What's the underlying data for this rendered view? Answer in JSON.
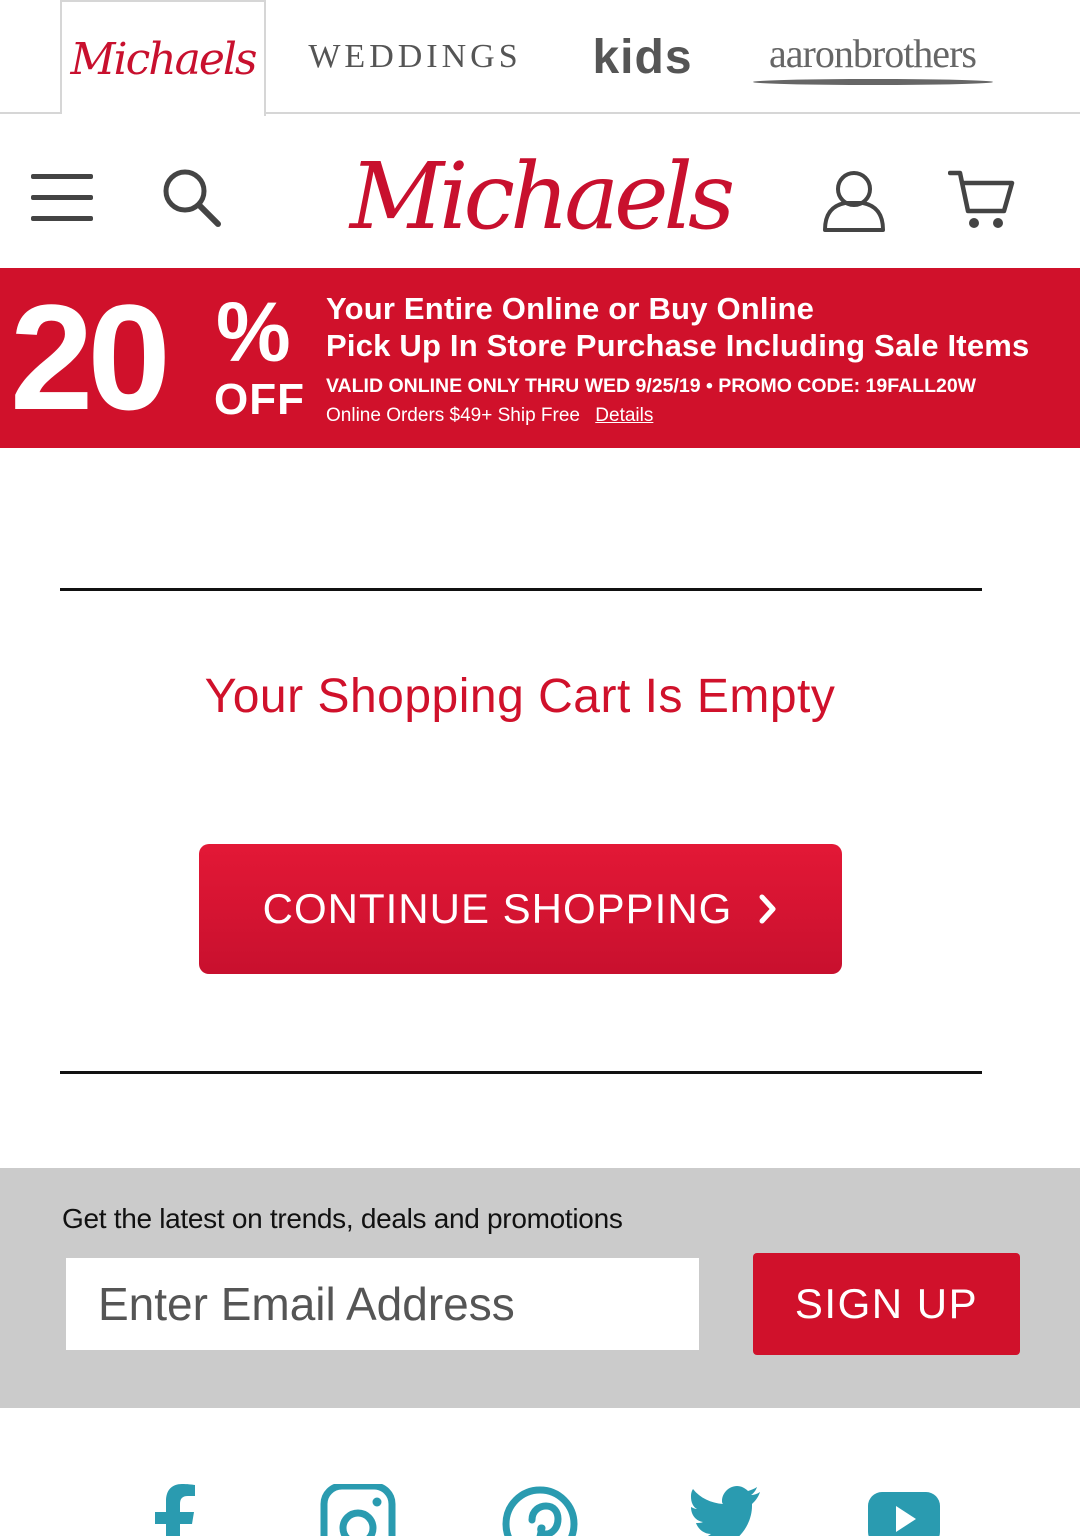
{
  "brand_tabs": {
    "michaels": "Michaels",
    "weddings": "WEDDINGS",
    "kids": "kids",
    "aaron_brothers": "aaronbrothers"
  },
  "header": {
    "logo": "Michaels",
    "icons": [
      "hamburger-menu-icon",
      "search-icon",
      "account-icon",
      "cart-icon"
    ]
  },
  "promo": {
    "percent": "20",
    "percent_sign": "%",
    "off": "OFF",
    "headline_1": "Your Entire Online or Buy Online",
    "headline_2": "Pick Up In Store Purchase Including Sale Items",
    "valid": "VALID ONLINE ONLY THRU WED 9/25/19 • PROMO CODE: 19FALL20W",
    "shipping": "Online Orders $49+ Ship Free",
    "details_link": "Details"
  },
  "cart": {
    "empty_message": "Your Shopping Cart Is Empty",
    "continue_label": "CONTINUE SHOPPING"
  },
  "newsletter": {
    "blurb": "Get the latest on trends, deals and promotions",
    "email_placeholder": "Enter Email Address",
    "email_value": "",
    "signup_label": "SIGN UP"
  },
  "social": {
    "icons": [
      "facebook-icon",
      "instagram-icon",
      "pinterest-icon",
      "twitter-icon",
      "youtube-icon"
    ]
  },
  "colors": {
    "brand_red": "#d0112b",
    "social_teal": "#2a9bb0",
    "newsletter_bg": "#cbcbcb",
    "icon_gray": "#444444"
  }
}
